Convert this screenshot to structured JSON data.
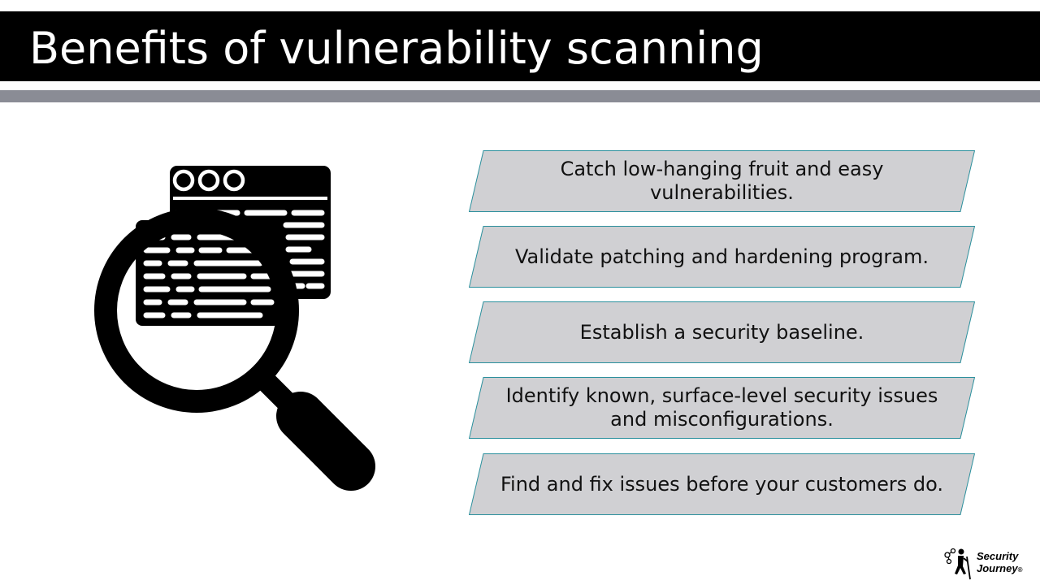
{
  "slide": {
    "title": "Benefits of vulnerability scanning",
    "benefits": [
      "Catch low-hanging fruit and easy vulnerabilities.",
      "Validate patching and hardening program.",
      "Establish a security baseline.",
      "Identify known, surface-level security issues and misconfigurations.",
      "Find and fix issues before your customers do."
    ]
  },
  "logo": {
    "line1": "Security",
    "line2": "Journey",
    "registered": "®"
  },
  "colors": {
    "title_bar": "#000000",
    "accent_bar": "#8a8c95",
    "benefit_fill": "#d0d0d3",
    "benefit_border": "#2a8f9c"
  },
  "icons": {
    "main_illustration": "magnifier-over-browser-window-icon",
    "logo_figure": "hiker-icon"
  }
}
